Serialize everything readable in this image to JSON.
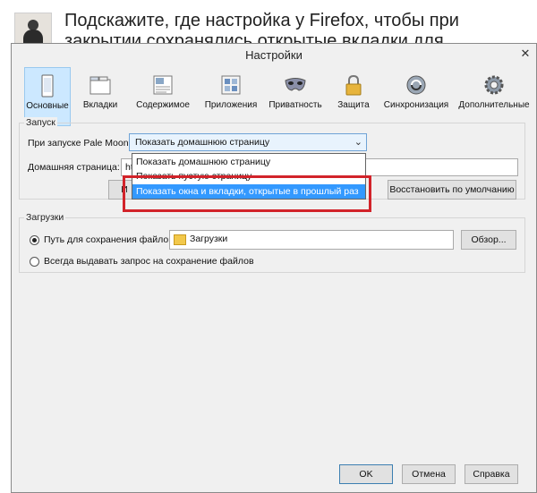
{
  "question": {
    "title": "Подскажите, где настройка у Firefox, чтобы при закрытии сохранялись открытые вкладки для следующей сессии?"
  },
  "dialog": {
    "title": "Настройки",
    "close_symbol": "✕",
    "toolbar": [
      {
        "label": "Основные",
        "icon": "general-icon",
        "active": true
      },
      {
        "label": "Вкладки",
        "icon": "tabs-icon",
        "active": false
      },
      {
        "label": "Содержимое",
        "icon": "content-icon",
        "active": false
      },
      {
        "label": "Приложения",
        "icon": "applications-icon",
        "active": false
      },
      {
        "label": "Приватность",
        "icon": "privacy-mask-icon",
        "active": false
      },
      {
        "label": "Защита",
        "icon": "padlock-icon",
        "active": false
      },
      {
        "label": "Синхронизация",
        "icon": "sync-icon",
        "active": false
      },
      {
        "label": "Дополнительные",
        "icon": "gear-icon",
        "active": false
      }
    ],
    "startup": {
      "legend": "Запуск",
      "on_start_label": "При запуске Pale Moon:",
      "on_start_value": "Показать домашнюю страницу",
      "homepage_label": "Домашняя страница:",
      "homepage_value": "ht",
      "dropdown_options": [
        "Показать домашнюю страницу",
        "Показать пустую страницу",
        "Показать окна и вкладки, открытые в прошлый раз"
      ],
      "dropdown_selected_index": 2,
      "button_partial_label": "И",
      "restore_default_button": "Восстановить по умолчанию"
    },
    "downloads": {
      "legend": "Загрузки",
      "save_path_label": "Путь для сохранения файлов",
      "folder_value": "Загрузки",
      "browse_button": "Обзор...",
      "always_ask_label": "Всегда выдавать запрос на сохранение файлов",
      "selected_option": "save_path"
    },
    "footer": {
      "ok": "OK",
      "cancel": "Отмена",
      "help": "Справка"
    },
    "colors": {
      "highlight": "#d2232a",
      "selection": "#3399ff",
      "active_tab": "#cce8ff"
    }
  }
}
